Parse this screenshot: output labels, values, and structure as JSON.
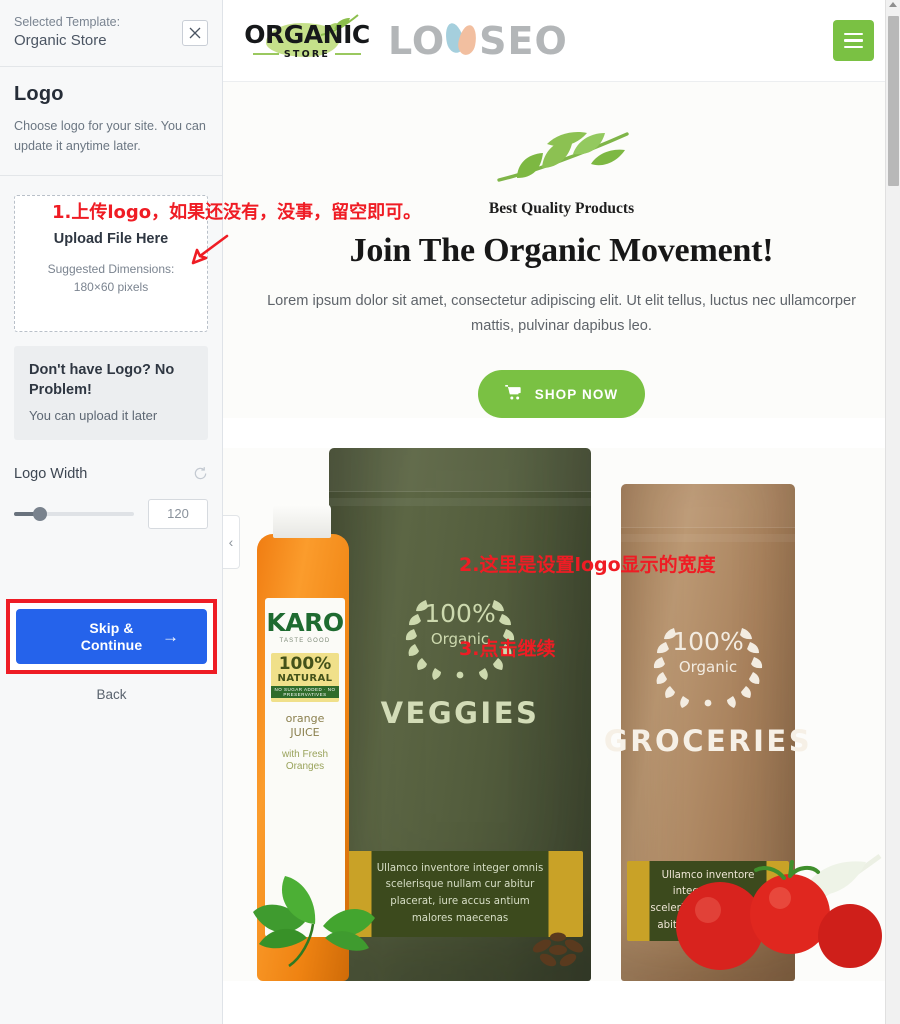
{
  "sidebar": {
    "template_bar": {
      "label": "Selected Template:",
      "value": "Organic Store",
      "close_icon": "close-icon"
    },
    "section": {
      "title": "Logo",
      "description": "Choose logo for your site. You can update it anytime later."
    },
    "upload": {
      "title": "Upload File Here",
      "subtitle": "Suggested Dimensions:\n180×60 pixels"
    },
    "notice": {
      "title": "Don't have Logo? No Problem!",
      "subtitle": "You can upload it later"
    },
    "logo_width": {
      "label": "Logo Width",
      "reset_icon": "reset-icon",
      "value": "120",
      "slider_percent": 22
    },
    "actions": {
      "primary_label": "Skip &\nContinue",
      "primary_arrow": "arrow-right-icon",
      "back_label": "Back",
      "highlight_color": "#ee1c25",
      "primary_color": "#2563eb"
    }
  },
  "preview": {
    "collapse_icon": "chevron-left-icon",
    "header": {
      "logo_word": "ORGANIC",
      "logo_sub": "STORE",
      "watermark": {
        "left": "LO",
        "right": "SEO"
      },
      "menu_icon": "hamburger-menu-icon"
    },
    "hero": {
      "leaf_icon": "leaf-branch-icon",
      "eyebrow": "Best Quality Products",
      "heading": "Join The Organic Movement!",
      "paragraph": "Lorem ipsum dolor sit amet, consectetur adipiscing elit. Ut elit tellus, luctus nec ullamcorper mattis, pulvinar dapibus leo.",
      "cta_label": "SHOP NOW",
      "cta_icon": "shopping-cart-icon",
      "cta_color": "#7ac143"
    },
    "products": {
      "green_bag": {
        "badge_percent": "100%",
        "badge_word": "Organic",
        "name": "VEGGIES",
        "label_text": "Ullamco inventore integer omnis scelerisque nullam cur abitur placerat, iure accus antium malores maecenas"
      },
      "brown_bag": {
        "badge_percent": "100%",
        "badge_word": "Organic",
        "name": "GROCERIES",
        "label_text": "Ullamco inventore integer omnis scelerisque nullam cur abitur placerat, iure"
      },
      "bottle": {
        "brand": "KARO",
        "brand_sub": "TASTE GOOD",
        "claim_number": "100%",
        "claim_word": "NATURAL",
        "claim_strip": "NO SUGAR ADDED · NO PRESERVATIVES",
        "product": "orange\nJUICE",
        "tagline": "with Fresh\nOranges"
      }
    }
  },
  "annotations": {
    "one": "1.上传logo，如果还没有，没事，留空即可。",
    "two": "2.这里是设置logo显示的宽度",
    "three": "3.点击继续",
    "arrow_icon": "arrow-up-left-icon",
    "color": "#ef1c24"
  },
  "scrollbar": {
    "position_percent": 2
  }
}
